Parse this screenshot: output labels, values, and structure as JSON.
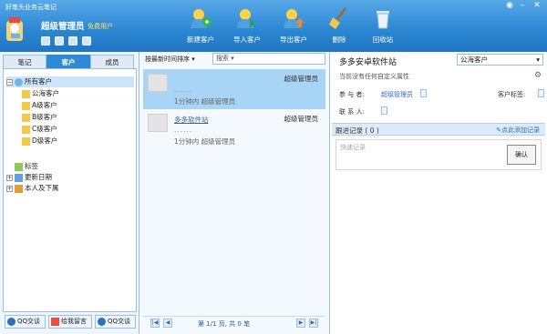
{
  "app": {
    "title": "好笔头业务云笔记"
  },
  "user": {
    "name": "超级管理员",
    "type": "免费用户"
  },
  "toolbar": [
    {
      "label": "新建客户",
      "icon": "new-customer-icon"
    },
    {
      "label": "导入客户",
      "icon": "import-customer-icon"
    },
    {
      "label": "导出客户",
      "icon": "export-customer-icon"
    },
    {
      "label": "删除",
      "icon": "broom-icon"
    },
    {
      "label": "回收站",
      "icon": "recycle-bin-icon"
    }
  ],
  "tabs": [
    "笔记",
    "客户",
    "成员"
  ],
  "tree": {
    "root": "所有客户",
    "children": [
      "公海客户",
      "A级客户",
      "B级客户",
      "C级客户",
      "D级客户"
    ],
    "groups": [
      "标签",
      "更新日期",
      "本人及下属"
    ]
  },
  "left_bottom": [
    "QQ交谈",
    "给我留言",
    "QQ交谈"
  ],
  "list": {
    "sort_label": "按最新时间排序",
    "search_placeholder": "搜索",
    "cards": [
      {
        "name": "",
        "owner": "超级管理员",
        "dots": "......",
        "time": "1分钟内 超级管理员"
      },
      {
        "name": "多多软件站",
        "owner": "超级管理员",
        "dots": "......",
        "time": "1分钟内 超级管理员"
      }
    ],
    "pager": {
      "text": "第 1/1 页, 共 0 笔"
    }
  },
  "detail": {
    "customer_name": "多多安卓软件站",
    "category": "公海客户",
    "attr_note": "当前没有任何自定义属性",
    "participant_label": "参 与 者:",
    "participant_value": "超级管理员",
    "tag_label": "客户标签:",
    "contact_label": "联 系 人:",
    "followup_title": "跟进记录 ( 0 )",
    "add_record": "点此添加记录",
    "quick_placeholder": "快速记录",
    "confirm": "确认"
  },
  "colors": {
    "accent": "#2e8ad6",
    "selected": "#a8d5f5"
  }
}
